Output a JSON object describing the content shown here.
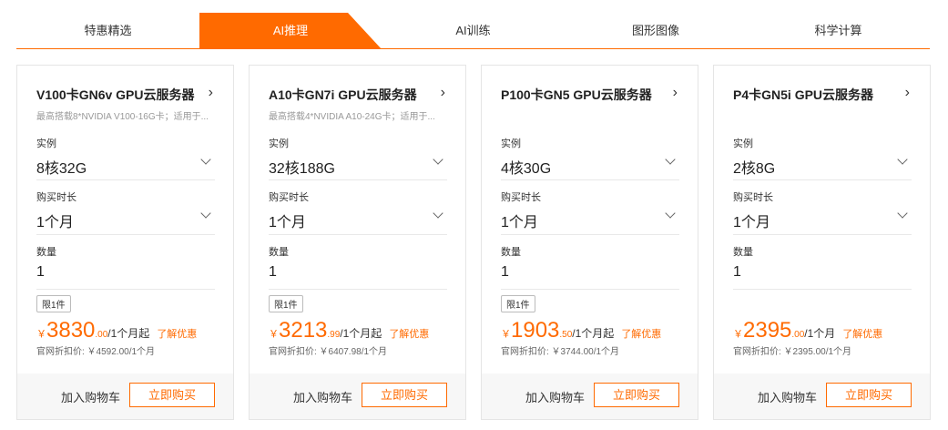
{
  "tabs": [
    {
      "label": "特惠精选",
      "active": false
    },
    {
      "label": "AI推理",
      "active": true
    },
    {
      "label": "AI训练",
      "active": false
    },
    {
      "label": "图形图像",
      "active": false
    },
    {
      "label": "科学计算",
      "active": false
    }
  ],
  "colors": {
    "accent": "#ff6a00",
    "border": "#e5e5e5",
    "footer_bg": "#f7f7f7"
  },
  "icons": {
    "title_arrow": "chevron-right-icon",
    "dropdown": "chevron-down-icon"
  },
  "labels": {
    "instance": "实例",
    "duration": "购买时长",
    "quantity": "数量",
    "limit": "限1件",
    "currency": "￥",
    "promo": "了解优惠",
    "add_cart": "加入购物车",
    "buy_now": "立即购买"
  },
  "cards": [
    {
      "title": "V100卡GN6v GPU云服务器",
      "desc": "最高搭载8*NVIDIA V100-16G卡；适用于...",
      "instance": "8核32G",
      "duration": "1个月",
      "quantity": "1",
      "limit": true,
      "price_int": "3830",
      "price_dec": ".00",
      "price_unit": "/1个月起",
      "original": "官网折扣价: ￥4592.00/1个月"
    },
    {
      "title": "A10卡GN7i GPU云服务器",
      "desc": "最高搭载4*NVIDIA A10-24G卡；适用于...",
      "instance": "32核188G",
      "duration": "1个月",
      "quantity": "1",
      "limit": true,
      "price_int": "3213",
      "price_dec": ".99",
      "price_unit": "/1个月起",
      "original": "官网折扣价: ￥6407.98/1个月"
    },
    {
      "title": "P100卡GN5 GPU云服务器",
      "desc": "",
      "instance": "4核30G",
      "duration": "1个月",
      "quantity": "1",
      "limit": true,
      "price_int": "1903",
      "price_dec": ".50",
      "price_unit": "/1个月起",
      "original": "官网折扣价: ￥3744.00/1个月"
    },
    {
      "title": "P4卡GN5i GPU云服务器",
      "desc": "",
      "instance": "2核8G",
      "duration": "1个月",
      "quantity": "1",
      "limit": false,
      "price_int": "2395",
      "price_dec": ".00",
      "price_unit": "/1个月",
      "original": "官网折扣价: ￥2395.00/1个月"
    }
  ]
}
